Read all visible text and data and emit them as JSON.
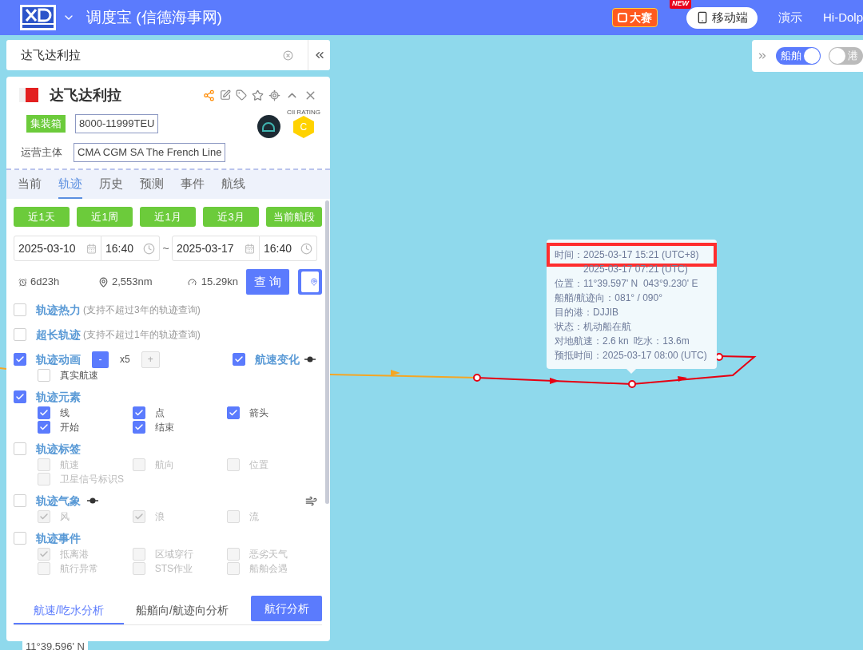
{
  "header": {
    "title": "调度宝 (信德海事网)",
    "contest_badge": "大赛",
    "new_tag": "NEW",
    "mobile_button": "移动端",
    "links": [
      "演示",
      "Hi-Dolp"
    ]
  },
  "search": {
    "value": "达飞达利拉"
  },
  "layer_toggles": [
    {
      "label": "船舶",
      "on": true
    },
    {
      "label": "港",
      "on": false
    }
  ],
  "vessel": {
    "name": "达飞达利拉",
    "type_tag": "集装箱",
    "capacity": "8000-11999TEU",
    "operator_label": "运营主体",
    "operator": "CMA CGM SA The French Line",
    "rating_caption": "CII RATING",
    "rating": "C"
  },
  "tabs": [
    {
      "label": "当前",
      "selected": false
    },
    {
      "label": "轨迹",
      "selected": true
    },
    {
      "label": "历史",
      "selected": false
    },
    {
      "label": "预测",
      "selected": false
    },
    {
      "label": "事件",
      "selected": false
    },
    {
      "label": "航线",
      "selected": false
    }
  ],
  "quick_ranges": [
    "近1天",
    "近1周",
    "近1月",
    "近3月",
    "当前航段"
  ],
  "range": {
    "start_date": "2025-03-10",
    "start_time": "16:40",
    "separator": "~",
    "end_date": "2025-03-17",
    "end_time": "16:40"
  },
  "stats": {
    "duration": "6d23h",
    "distance": "2,553nm",
    "speed": "15.29kn",
    "query_button": "查 询"
  },
  "options": [
    {
      "label": "轨迹热力",
      "note": "(支持不超过3年的轨迹查询)",
      "checked": false
    },
    {
      "label": "超长轨迹",
      "note": "(支持不超过1年的轨迹查询)",
      "checked": false
    },
    {
      "label": "轨迹动画",
      "checked": true,
      "stepper": {
        "minus": "-",
        "value": "x5",
        "plus": "+"
      },
      "extra": {
        "label": "航速变化",
        "checked": true
      },
      "sub": [
        {
          "label": "真实航速",
          "checked": false,
          "disabled": false
        }
      ]
    },
    {
      "label": "轨迹元素",
      "checked": true,
      "sub": [
        {
          "label": "线",
          "checked": true,
          "disabled": false
        },
        {
          "label": "点",
          "checked": true,
          "disabled": false
        },
        {
          "label": "箭头",
          "checked": true,
          "disabled": false
        },
        {
          "label": "开始",
          "checked": true,
          "disabled": false
        },
        {
          "label": "结束",
          "checked": true,
          "disabled": false
        }
      ]
    },
    {
      "label": "轨迹标签",
      "checked": false,
      "sub": [
        {
          "label": "航速",
          "checked": false,
          "disabled": true
        },
        {
          "label": "航向",
          "checked": false,
          "disabled": true
        },
        {
          "label": "位置",
          "checked": false,
          "disabled": true
        },
        {
          "label": "卫星信号标识S",
          "checked": false,
          "disabled": true
        }
      ]
    },
    {
      "label": "轨迹气象",
      "checked": false,
      "sub": [
        {
          "label": "风",
          "checked": true,
          "disabled": true
        },
        {
          "label": "浪",
          "checked": true,
          "disabled": true
        },
        {
          "label": "流",
          "checked": false,
          "disabled": true
        }
      ]
    },
    {
      "label": "轨迹事件",
      "checked": false,
      "sub": [
        {
          "label": "抵离港",
          "checked": true,
          "disabled": true
        },
        {
          "label": "区域穿行",
          "checked": false,
          "disabled": true
        },
        {
          "label": "恶劣天气",
          "checked": false,
          "disabled": true
        },
        {
          "label": "航行异常",
          "checked": false,
          "disabled": true
        },
        {
          "label": "STS作业",
          "checked": false,
          "disabled": true
        },
        {
          "label": "船舶会遇",
          "checked": false,
          "disabled": true
        }
      ]
    }
  ],
  "analysis_tabs": [
    {
      "label": "航速/吃水分析",
      "selected": true
    },
    {
      "label": "船艏向/航迹向分析",
      "selected": false
    }
  ],
  "analysis_button": "航行分析",
  "below_panel": "11°39.596' N",
  "tooltip": {
    "highlighted": "时间：2025-03-17 15:21 (UTC+8)",
    "lines": [
      "2025-03-17 07:21 (UTC)",
      "位置：11°39.597' N  043°9.230' E",
      "船艏/航迹向：081° / 090°",
      "目的港：DJJIB",
      "状态：机动船在航",
      "对地航速：2.6 kn  吃水：13.6m",
      "预抵时间：2025-03-17 08:00 (UTC)"
    ]
  }
}
